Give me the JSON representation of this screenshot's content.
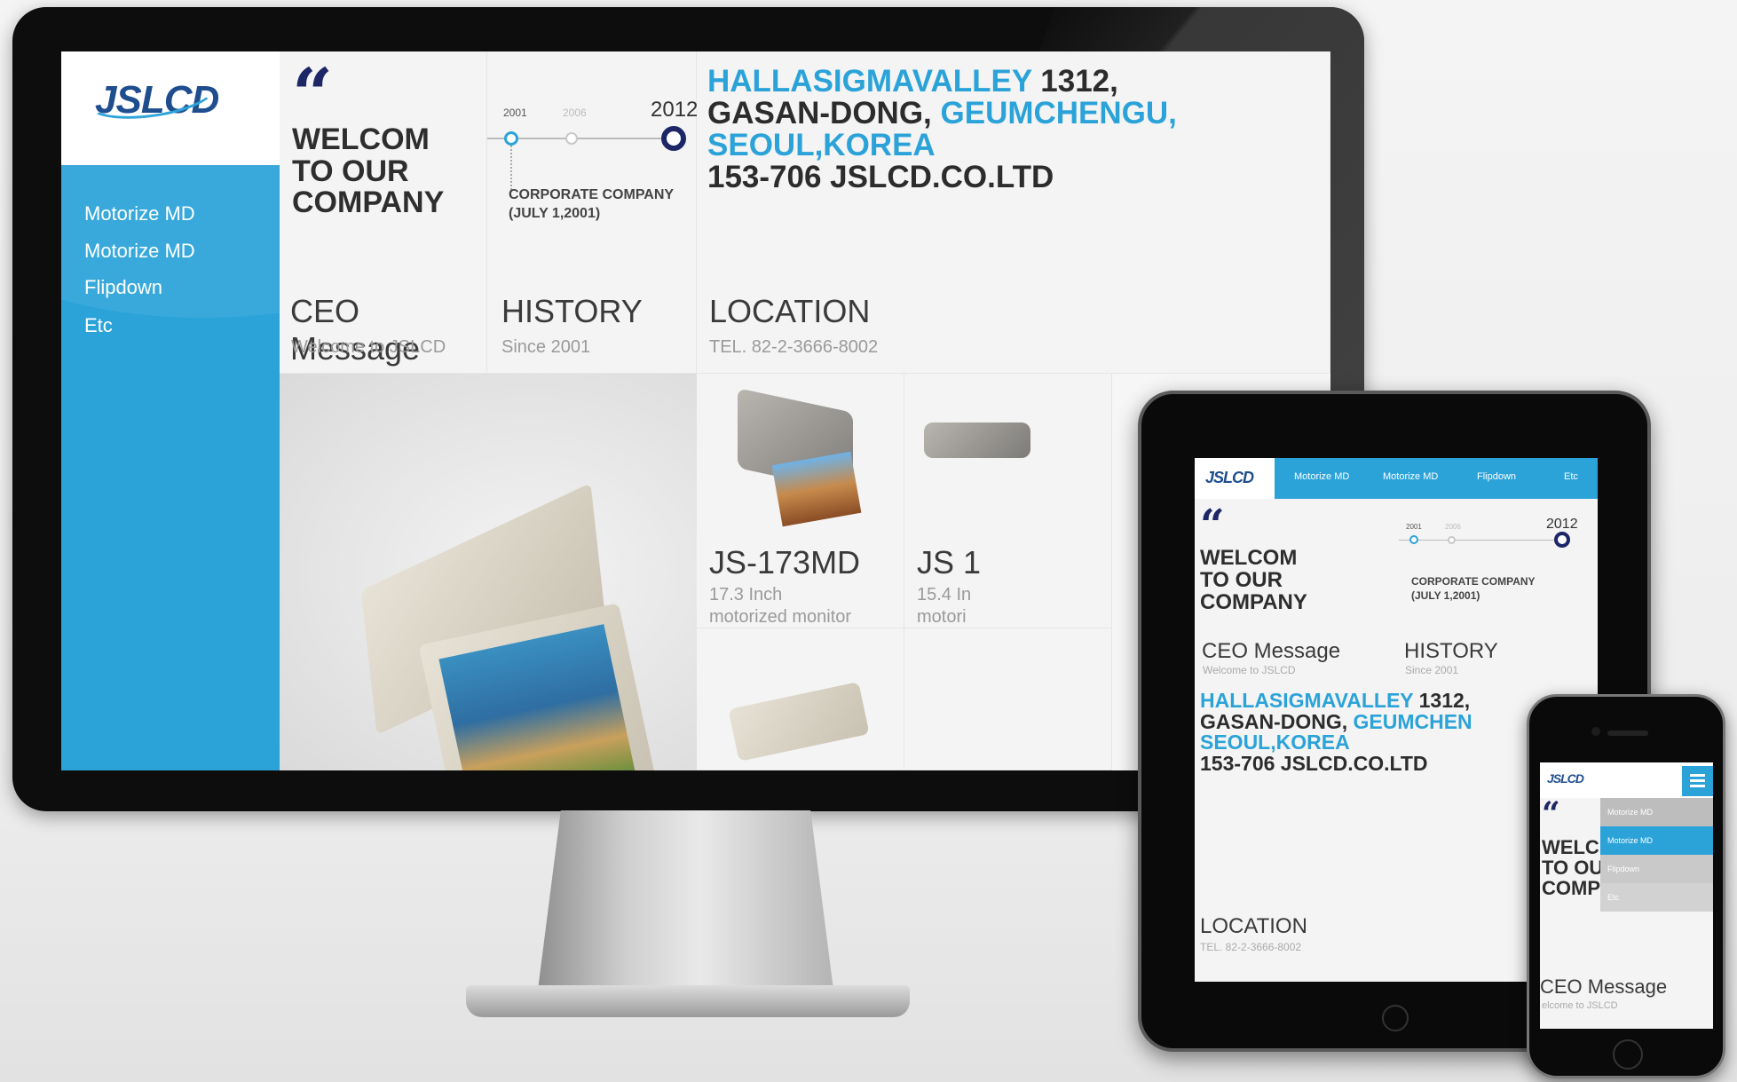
{
  "brand": {
    "logo": "JSLCD",
    "accent": "#2ba3d9",
    "navy": "#1d2767"
  },
  "nav": [
    "Motorize MD",
    "Motorize MD",
    "Flipdown",
    "Etc"
  ],
  "welcome": {
    "quote_mark": "66",
    "lines": [
      "WELCOM",
      "TO OUR",
      "COMPANY"
    ]
  },
  "ceo": {
    "title": "CEO Message",
    "sub": "Welcome to JSLCD"
  },
  "history": {
    "years": [
      "2001",
      "2006",
      "2012"
    ],
    "event_line1": "CORPORATE COMPANY",
    "event_line2": "(JULY 1,2001)",
    "title": "HISTORY",
    "sub": "Since 2001"
  },
  "address": {
    "w1": "HALLASIGMAVALLEY",
    "w2": " 1312,",
    "w3": "GASAN-DONG, ",
    "w4": "GEUMCHENGU,",
    "w5": "SEOUL,KOREA",
    "w6": "153-706 JSLCD.CO.LTD",
    "t_w4": "GEUMCHEN"
  },
  "location": {
    "title": "LOCATION",
    "sub": "TEL. 82-2-3666-8002"
  },
  "products": [
    {
      "name": "JS-173MD",
      "size": "17.3 Inch",
      "desc": "motorized monitor"
    },
    {
      "name": "JS 1",
      "size": "15.4 In",
      "desc": "motori"
    }
  ],
  "phone": {
    "welcome": [
      "WELC",
      "TO OU",
      "COMP"
    ],
    "ceo_title": "CEO Message",
    "ceo_sub": "elcome to JSLCD",
    "menu_icon": "hamburger-menu-icon"
  }
}
